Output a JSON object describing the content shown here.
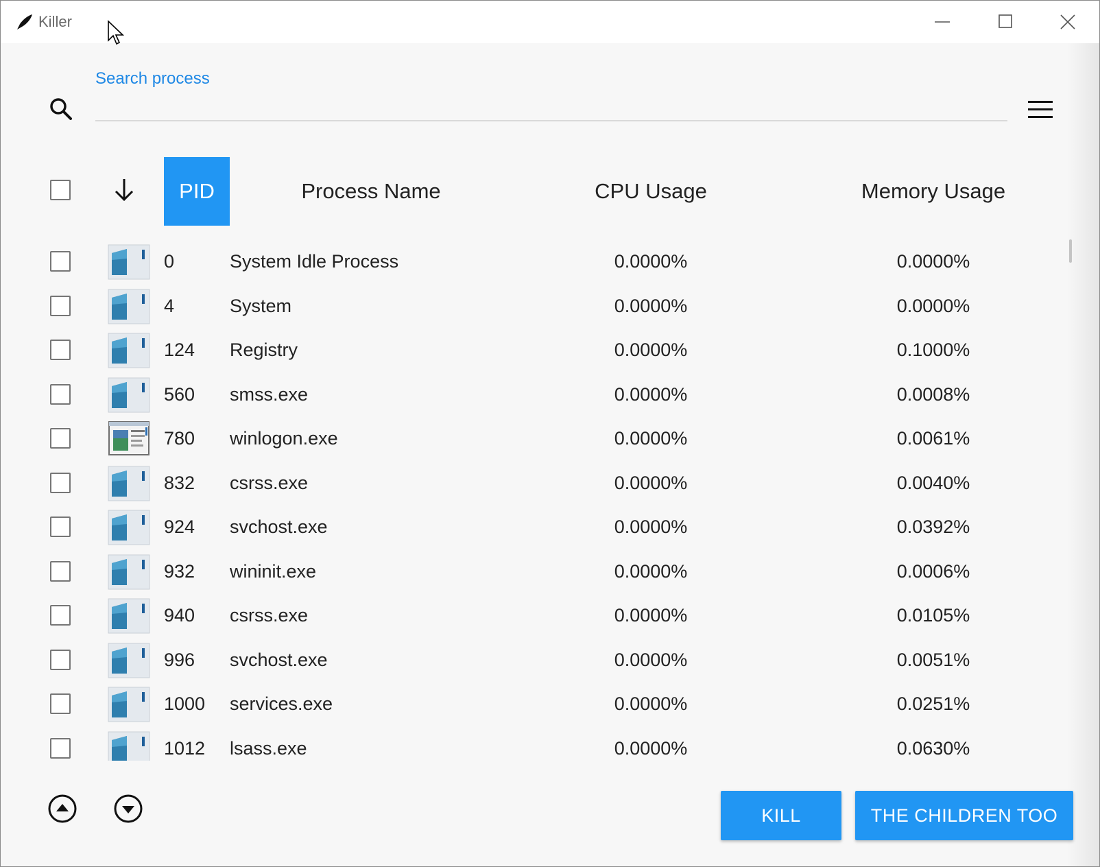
{
  "window": {
    "title": "Killer",
    "app_icon": "quill-icon",
    "controls": [
      "minimize-icon",
      "maximize-icon",
      "close-icon"
    ]
  },
  "search": {
    "label": "Search process",
    "value": "",
    "icon": "search-icon"
  },
  "menu": {
    "icon": "hamburger-menu-icon"
  },
  "table": {
    "headers": {
      "pid": "PID",
      "name": "Process Name",
      "cpu": "CPU Usage",
      "memory": "Memory Usage"
    },
    "sort_icon": "arrow-down-icon",
    "active_sort_column": "PID",
    "rows": [
      {
        "pid": "0",
        "name": "System Idle Process",
        "cpu": "0.0000%",
        "memory": "0.0000%",
        "icon": "generic-app-icon",
        "checked": false
      },
      {
        "pid": "4",
        "name": "System",
        "cpu": "0.0000%",
        "memory": "0.0000%",
        "icon": "generic-app-icon",
        "checked": false
      },
      {
        "pid": "124",
        "name": "Registry",
        "cpu": "0.0000%",
        "memory": "0.1000%",
        "icon": "generic-app-icon",
        "checked": false
      },
      {
        "pid": "560",
        "name": "smss.exe",
        "cpu": "0.0000%",
        "memory": "0.0008%",
        "icon": "generic-app-icon",
        "checked": false
      },
      {
        "pid": "780",
        "name": "winlogon.exe",
        "cpu": "0.0000%",
        "memory": "0.0061%",
        "icon": "window-app-icon",
        "checked": false
      },
      {
        "pid": "832",
        "name": "csrss.exe",
        "cpu": "0.0000%",
        "memory": "0.0040%",
        "icon": "generic-app-icon",
        "checked": false
      },
      {
        "pid": "924",
        "name": "svchost.exe",
        "cpu": "0.0000%",
        "memory": "0.0392%",
        "icon": "generic-app-icon",
        "checked": false
      },
      {
        "pid": "932",
        "name": "wininit.exe",
        "cpu": "0.0000%",
        "memory": "0.0006%",
        "icon": "generic-app-icon",
        "checked": false
      },
      {
        "pid": "940",
        "name": "csrss.exe",
        "cpu": "0.0000%",
        "memory": "0.0105%",
        "icon": "generic-app-icon",
        "checked": false
      },
      {
        "pid": "996",
        "name": "svchost.exe",
        "cpu": "0.0000%",
        "memory": "0.0051%",
        "icon": "generic-app-icon",
        "checked": false
      },
      {
        "pid": "1000",
        "name": "services.exe",
        "cpu": "0.0000%",
        "memory": "0.0251%",
        "icon": "generic-app-icon",
        "checked": false
      },
      {
        "pid": "1012",
        "name": "lsass.exe",
        "cpu": "0.0000%",
        "memory": "0.0630%",
        "icon": "generic-app-icon",
        "checked": false
      }
    ]
  },
  "footer": {
    "scroll_up_icon": "circle-arrow-up-icon",
    "scroll_down_icon": "circle-arrow-down-icon",
    "kill_label": "KILL",
    "kill_children_label": "THE CHILDREN TOO"
  },
  "colors": {
    "accent": "#2196f3",
    "link": "#1e88e5",
    "background": "#f7f7f7",
    "text": "#222222"
  }
}
